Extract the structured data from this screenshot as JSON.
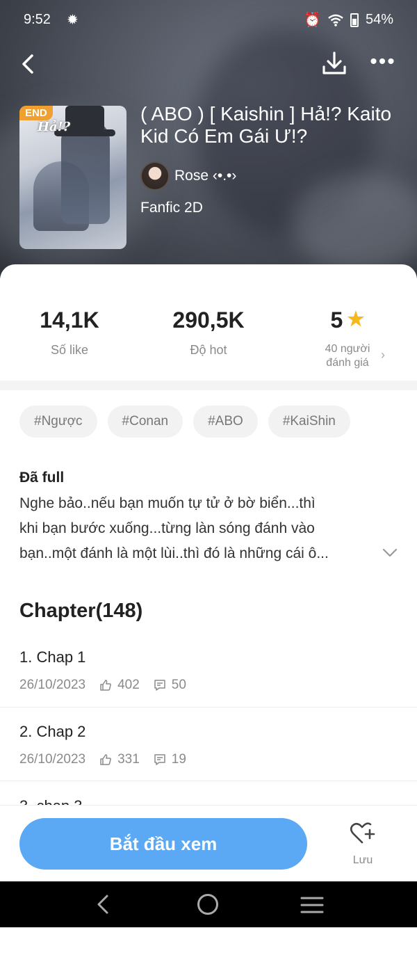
{
  "status": {
    "time": "9:52",
    "battery": "54%"
  },
  "story": {
    "badge": "END",
    "cover_title": "Hả!?",
    "title": "( ABO ) [ Kaishin ] Hả!? Kaito Kid Có Em Gái Ư!?",
    "author": "Rose ‹•.•›",
    "category": "Fanfic 2D"
  },
  "stats": {
    "likes_value": "14,1K",
    "likes_label": "Số like",
    "hot_value": "290,5K",
    "hot_label": "Độ hot",
    "rating_value": "5",
    "rating_label": "40 người đánh giá"
  },
  "tags": [
    "#Ngược",
    "#Conan",
    "#ABO",
    "#KaiShin"
  ],
  "description": {
    "heading": "Đã full",
    "lines": [
      "Nghe bảo..nếu bạn muốn tự tử ở bờ biển...thì",
      "khi bạn bước xuống...từng làn sóng đánh vào",
      "bạn..một đánh là một lùi..thì đó là những cái ô..."
    ]
  },
  "chapters": {
    "heading": "Chapter(148)",
    "items": [
      {
        "title": "1. Chap 1",
        "date": "26/10/2023",
        "likes": "402",
        "comments": "50"
      },
      {
        "title": "2. Chap 2",
        "date": "26/10/2023",
        "likes": "331",
        "comments": "19"
      }
    ],
    "partial": "3. chap 3"
  },
  "actions": {
    "start": "Bắt đầu xem",
    "save": "Lưu"
  },
  "colors": {
    "accent": "#5ba8f4",
    "star": "#f6b81a",
    "badge": "#f0a030"
  },
  "icons": [
    "back-icon",
    "download-icon",
    "more-icon",
    "star-icon",
    "thumb-up-icon",
    "comment-icon",
    "heart-plus-icon",
    "chevron-down-icon"
  ]
}
